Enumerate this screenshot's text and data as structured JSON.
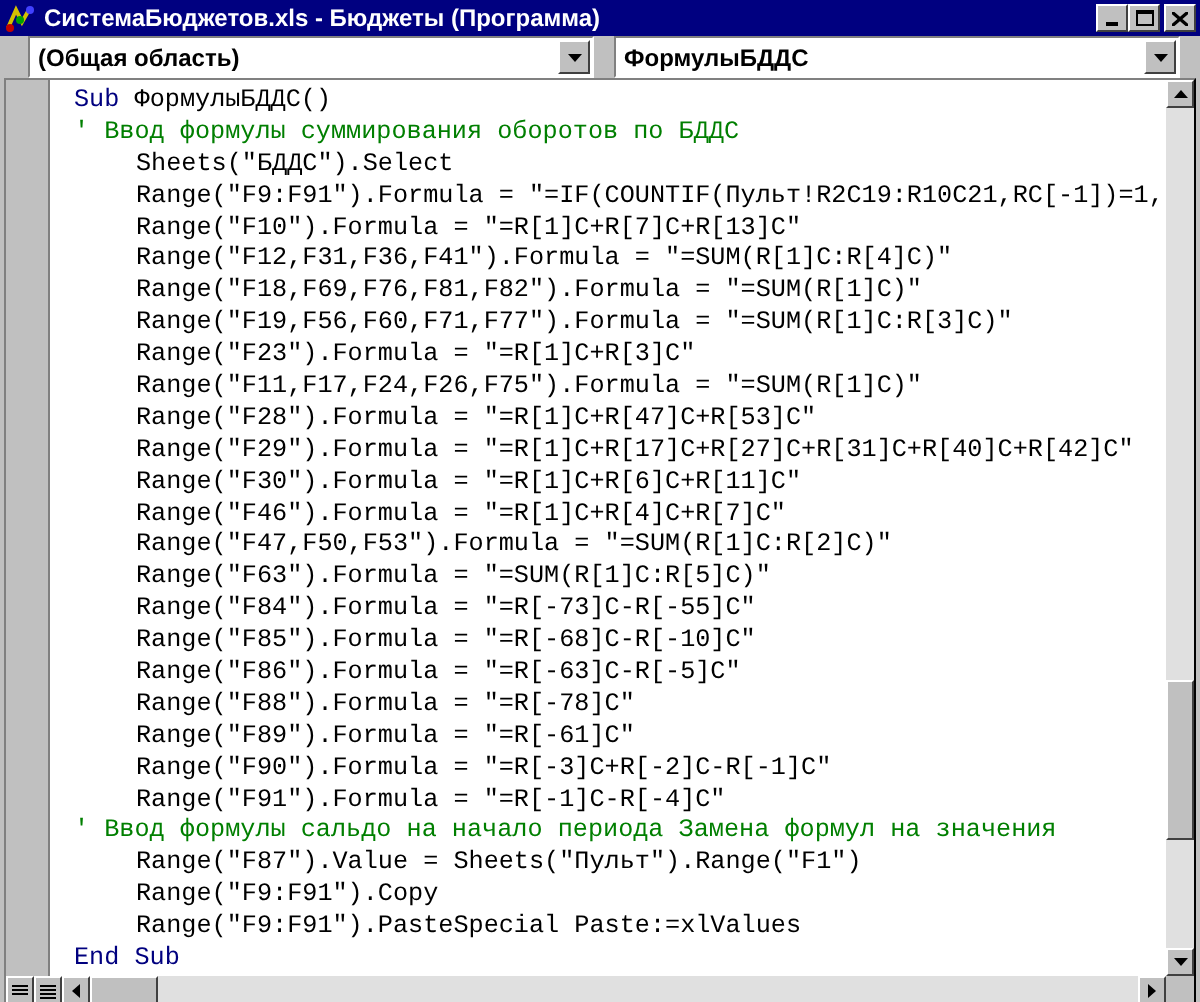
{
  "window": {
    "title": "СистемаБюджетов.xls - Бюджеты (Программа)"
  },
  "object_box": {
    "value": "(Общая область)"
  },
  "procedure_box": {
    "value": "ФормулыБДДС"
  },
  "code_lines": [
    {
      "kind": "keyword_line",
      "keyword": "Sub",
      "text": "ФормулыБДДС()"
    },
    {
      "kind": "comment",
      "text": "' Ввод формулы суммирования оборотов по БДДС"
    },
    {
      "kind": "statement",
      "text": "Sheets(\"БДДС\").Select"
    },
    {
      "kind": "statement",
      "text": "Range(\"F9:F91\").Formula = \"=IF(COUNTIF(Пульт!R2C19:R10C21,RC[-1])=1,"
    },
    {
      "kind": "statement",
      "text": "Range(\"F10\").Formula = \"=R[1]C+R[7]C+R[13]C\""
    },
    {
      "kind": "statement",
      "text": "Range(\"F12,F31,F36,F41\").Formula = \"=SUM(R[1]C:R[4]C)\""
    },
    {
      "kind": "statement",
      "text": "Range(\"F18,F69,F76,F81,F82\").Formula = \"=SUM(R[1]C)\""
    },
    {
      "kind": "statement",
      "text": "Range(\"F19,F56,F60,F71,F77\").Formula = \"=SUM(R[1]C:R[3]C)\""
    },
    {
      "kind": "statement",
      "text": "Range(\"F23\").Formula = \"=R[1]C+R[3]C\""
    },
    {
      "kind": "statement",
      "text": "Range(\"F11,F17,F24,F26,F75\").Formula = \"=SUM(R[1]C)\""
    },
    {
      "kind": "statement",
      "text": "Range(\"F28\").Formula = \"=R[1]C+R[47]C+R[53]C\""
    },
    {
      "kind": "statement",
      "text": "Range(\"F29\").Formula = \"=R[1]C+R[17]C+R[27]C+R[31]C+R[40]C+R[42]C\""
    },
    {
      "kind": "statement",
      "text": "Range(\"F30\").Formula = \"=R[1]C+R[6]C+R[11]C\""
    },
    {
      "kind": "statement",
      "text": "Range(\"F46\").Formula = \"=R[1]C+R[4]C+R[7]C\""
    },
    {
      "kind": "statement",
      "text": "Range(\"F47,F50,F53\").Formula = \"=SUM(R[1]C:R[2]C)\""
    },
    {
      "kind": "statement",
      "text": "Range(\"F63\").Formula = \"=SUM(R[1]C:R[5]C)\""
    },
    {
      "kind": "statement",
      "text": "Range(\"F84\").Formula = \"=R[-73]C-R[-55]C\""
    },
    {
      "kind": "statement",
      "text": "Range(\"F85\").Formula = \"=R[-68]C-R[-10]C\""
    },
    {
      "kind": "statement",
      "text": "Range(\"F86\").Formula = \"=R[-63]C-R[-5]C\""
    },
    {
      "kind": "statement",
      "text": "Range(\"F88\").Formula = \"=R[-78]C\""
    },
    {
      "kind": "statement",
      "text": "Range(\"F89\").Formula = \"=R[-61]C\""
    },
    {
      "kind": "statement",
      "text": "Range(\"F90\").Formula = \"=R[-3]C+R[-2]C-R[-1]C\""
    },
    {
      "kind": "statement",
      "text": "Range(\"F91\").Formula = \"=R[-1]C-R[-4]C\""
    },
    {
      "kind": "comment",
      "text": "' Ввод формулы сальдо на начало периода Замена формул на значения"
    },
    {
      "kind": "statement",
      "text": "Range(\"F87\").Value = Sheets(\"Пульт\").Range(\"F1\")"
    },
    {
      "kind": "statement",
      "text": "Range(\"F9:F91\").Copy"
    },
    {
      "kind": "statement",
      "text": "Range(\"F9:F91\").PasteSpecial Paste:=xlValues"
    },
    {
      "kind": "keyword_line",
      "keyword": "End Sub"
    }
  ]
}
